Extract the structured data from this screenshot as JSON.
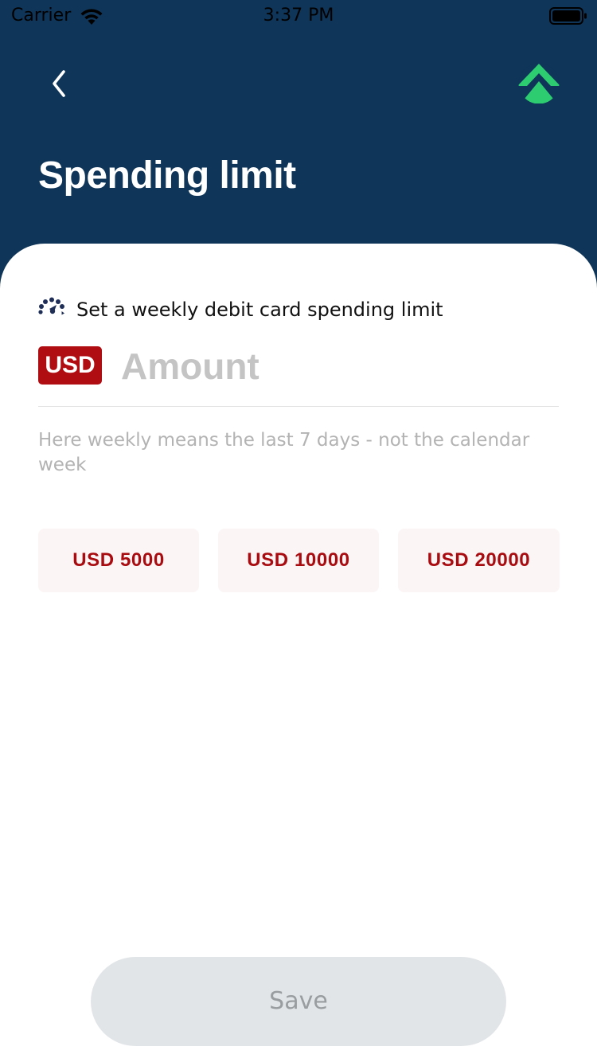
{
  "status_bar": {
    "carrier": "Carrier",
    "time": "3:37 PM"
  },
  "header": {
    "title": "Spending limit",
    "back_icon": "chevron-left-icon",
    "logo_icon": "brand-logo-icon",
    "logo_color": "#2ecc71",
    "background_color": "#0f3559"
  },
  "limit": {
    "icon": "gauge-icon",
    "label": "Set a weekly debit card spending limit",
    "currency": "USD",
    "amount_value": "",
    "amount_placeholder": "Amount",
    "hint": "Here weekly means the last 7 days - not the calendar week"
  },
  "presets": [
    "USD 5000",
    "USD 10000",
    "USD 20000"
  ],
  "save": {
    "label": "Save"
  },
  "colors": {
    "accent_red": "#b00d12",
    "preset_bg": "#fbf5f5",
    "save_disabled_bg": "#e2e5e8"
  }
}
